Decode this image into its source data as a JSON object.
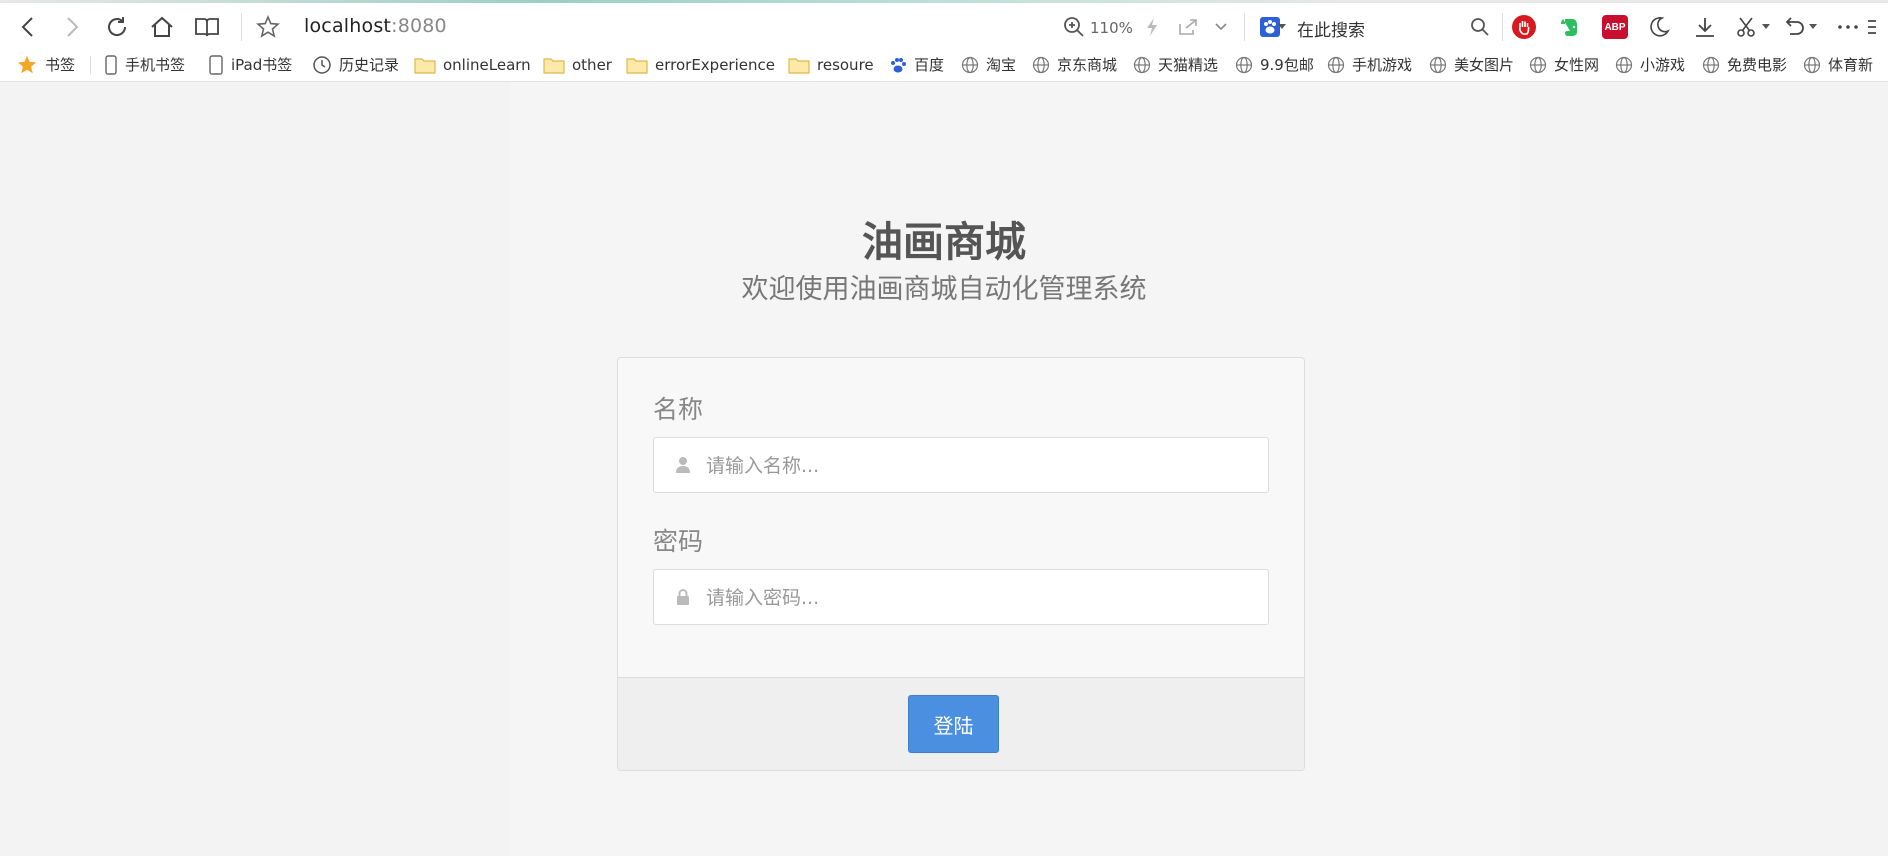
{
  "browser": {
    "url_host": "localhost",
    "url_port": ":8080",
    "zoom": "110%",
    "search_placeholder": "在此搜索"
  },
  "bookmarks": [
    {
      "label": "书签",
      "icon": "star-icon"
    },
    {
      "label": "手机书签",
      "icon": "phone-icon"
    },
    {
      "label": "iPad书签",
      "icon": "tablet-icon"
    },
    {
      "label": "历史记录",
      "icon": "clock-icon"
    },
    {
      "label": "onlineLearn",
      "icon": "folder-icon"
    },
    {
      "label": "other",
      "icon": "folder-icon"
    },
    {
      "label": "errorExperience",
      "icon": "folder-icon"
    },
    {
      "label": "resoure",
      "icon": "folder-icon"
    },
    {
      "label": "百度",
      "icon": "baidu-icon"
    },
    {
      "label": "淘宝",
      "icon": "globe-icon"
    },
    {
      "label": "京东商城",
      "icon": "globe-icon"
    },
    {
      "label": "天猫精选",
      "icon": "globe-icon"
    },
    {
      "label": "9.9包邮",
      "icon": "globe-icon"
    },
    {
      "label": "手机游戏",
      "icon": "globe-icon"
    },
    {
      "label": "美女图片",
      "icon": "globe-icon"
    },
    {
      "label": "女性网",
      "icon": "globe-icon"
    },
    {
      "label": "小游戏",
      "icon": "globe-icon"
    },
    {
      "label": "免费电影",
      "icon": "globe-icon"
    },
    {
      "label": "体育新",
      "icon": "globe-icon"
    }
  ],
  "page": {
    "title": "油画商城",
    "subtitle": "欢迎使用油画商城自动化管理系统"
  },
  "form": {
    "name_label": "名称",
    "name_placeholder": "请输入名称...",
    "password_label": "密码",
    "password_placeholder": "请输入密码...",
    "submit_label": "登陆"
  },
  "colors": {
    "primary_button": "#4a8fe0",
    "page_background": "#f3f3f3"
  }
}
